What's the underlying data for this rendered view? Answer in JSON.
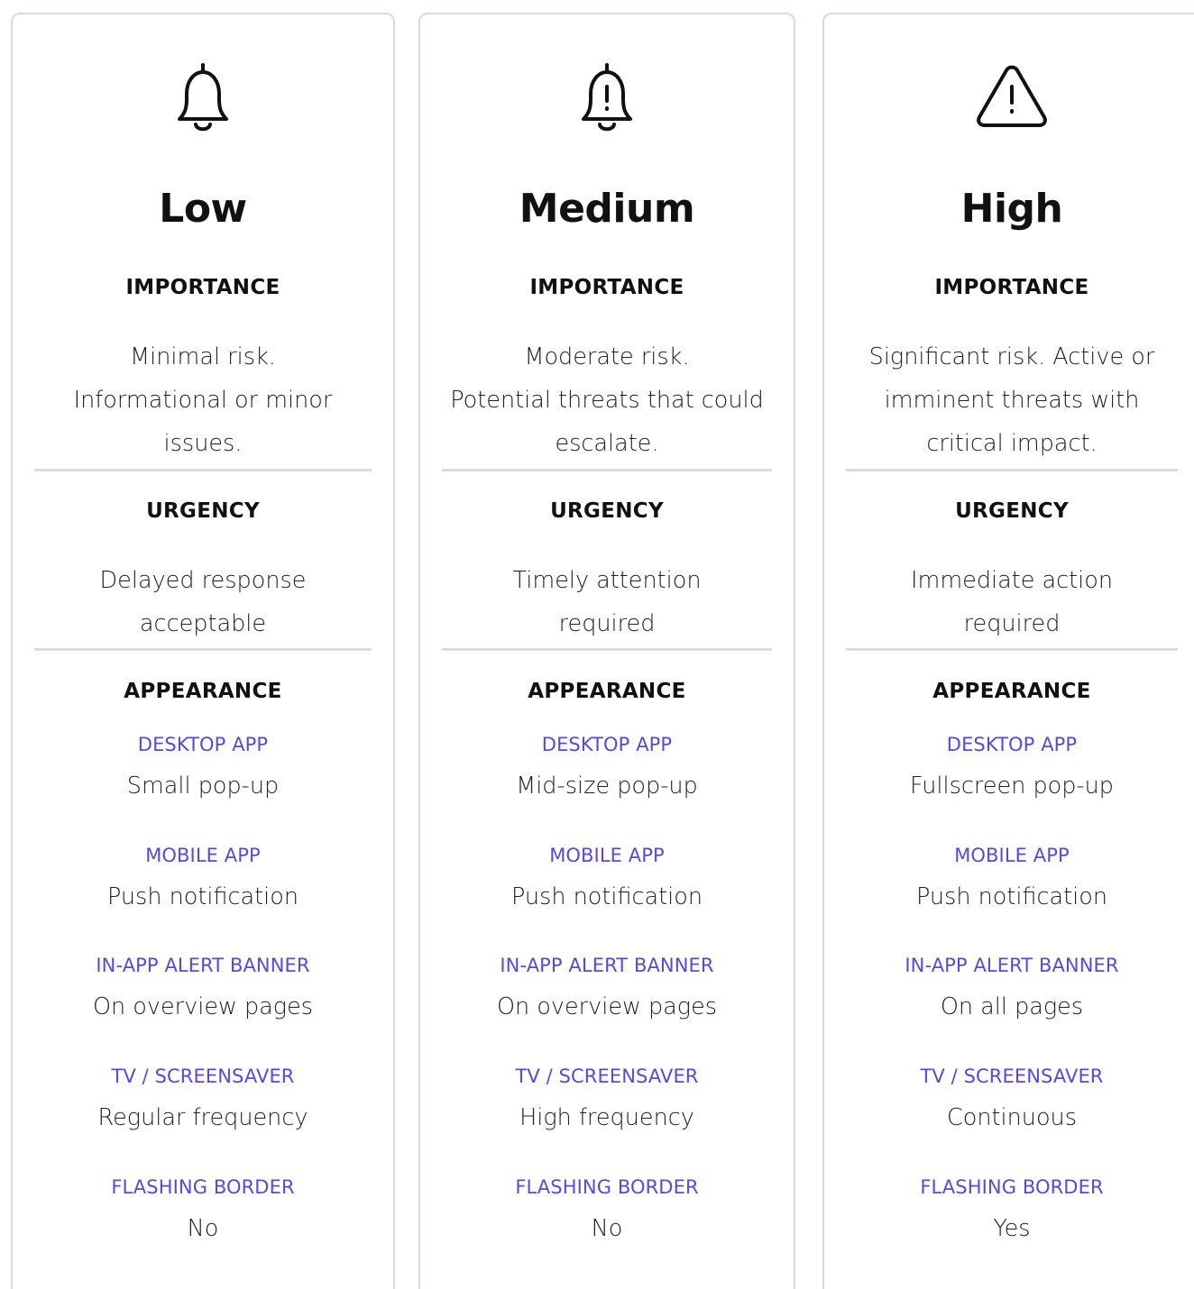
{
  "cards": [
    {
      "level": "Low",
      "icon": "bell-icon",
      "importance_heading": "IMPORTANCE",
      "importance_lines": [
        "Minimal risk.",
        "Informational  or minor",
        "issues."
      ],
      "urgency_heading": "URGENCY",
      "urgency_lines": [
        "Delayed response",
        "acceptable"
      ],
      "appearance_heading": "APPEARANCE",
      "appearance": [
        {
          "label": "DESKTOP APP",
          "value": "Small pop-up"
        },
        {
          "label": "MOBILE APP",
          "value": "Push notification"
        },
        {
          "label": "IN-APP ALERT BANNER",
          "value": "On overview pages"
        },
        {
          "label": "TV / SCREENSAVER",
          "value": "Regular frequency"
        },
        {
          "label": "FLASHING BORDER",
          "value": "No"
        }
      ]
    },
    {
      "level": "Medium",
      "icon": "bell-exclamation-icon",
      "importance_heading": "IMPORTANCE",
      "importance_lines": [
        "Moderate risk.",
        "Potential threats that could",
        "escalate."
      ],
      "urgency_heading": "URGENCY",
      "urgency_lines": [
        "Timely attention",
        "required"
      ],
      "appearance_heading": "APPEARANCE",
      "appearance": [
        {
          "label": "DESKTOP APP",
          "value": "Mid-size pop-up"
        },
        {
          "label": "MOBILE APP",
          "value": "Push notification"
        },
        {
          "label": "IN-APP ALERT BANNER",
          "value": "On overview pages"
        },
        {
          "label": "TV / SCREENSAVER",
          "value": "High frequency"
        },
        {
          "label": "FLASHING BORDER",
          "value": "No"
        }
      ]
    },
    {
      "level": "High",
      "icon": "warning-triangle-icon",
      "importance_heading": "IMPORTANCE",
      "importance_lines": [
        "Significant risk. Active or",
        "imminent threats with",
        "critical impact."
      ],
      "urgency_heading": "URGENCY",
      "urgency_lines": [
        "Immediate action",
        "required"
      ],
      "appearance_heading": "APPEARANCE",
      "appearance": [
        {
          "label": "DESKTOP APP",
          "value": "Fullscreen pop-up"
        },
        {
          "label": "MOBILE APP",
          "value": "Push notification"
        },
        {
          "label": "IN-APP ALERT BANNER",
          "value": "On all pages"
        },
        {
          "label": "TV / SCREENSAVER",
          "value": "Continuous"
        },
        {
          "label": "FLASHING BORDER",
          "value": "Yes"
        }
      ]
    }
  ],
  "colors": {
    "accent": "#5b48d9",
    "border": "#d9d9d9",
    "divider": "#dcdcdc",
    "text": "#111111"
  }
}
